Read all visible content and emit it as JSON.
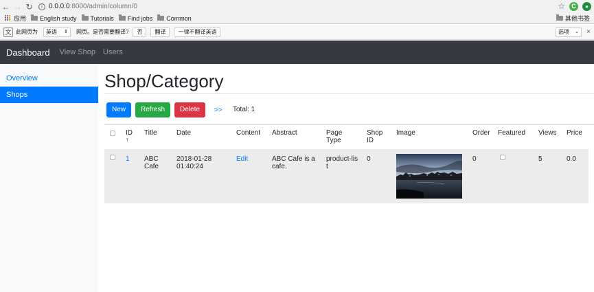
{
  "browser": {
    "url_host": "0.0.0.0",
    "url_path": ":8000/admin/column/0",
    "bookmarks": [
      "应用",
      "English study",
      "Tutorials",
      "Find jobs",
      "Common"
    ],
    "other_bookmarks": "其他书签",
    "ext1": "C",
    "ext2": "●"
  },
  "translate_bar": {
    "prefix": "此网页为",
    "language": "英语",
    "question": "网页。是否需要翻译?",
    "no_btn": "否",
    "translate_btn": "翻译",
    "never_btn": "一律不翻译英语",
    "options": "选项",
    "close": "×"
  },
  "navbar": {
    "brand": "Dashboard",
    "links": [
      "View Shop",
      "Users"
    ]
  },
  "sidebar": {
    "items": [
      {
        "label": "Overview",
        "active": false
      },
      {
        "label": "Shops",
        "active": true
      }
    ]
  },
  "page": {
    "title": "Shop/Category",
    "buttons": {
      "new": "New",
      "refresh": "Refresh",
      "delete": "Delete"
    },
    "next_link": ">>",
    "total": "Total: 1"
  },
  "table": {
    "headers": {
      "id": "ID",
      "sort_indicator": "↑",
      "title": "Title",
      "date": "Date",
      "content": "Content",
      "abstract": "Abstract",
      "page_type": "Page Type",
      "shop_id": "Shop ID",
      "image": "Image",
      "order": "Order",
      "featured": "Featured",
      "views": "Views",
      "price": "Price"
    },
    "rows": [
      {
        "id": "1",
        "title": "ABC Cafe",
        "date": "2018-01-28 01:40:24",
        "content": "Edit",
        "abstract": "ABC Cafe is a cafe.",
        "page_type": "product-list",
        "shop_id": "0",
        "image": "city-river-dusk-photo",
        "order": "0",
        "featured": false,
        "views": "5",
        "price": "0.0"
      }
    ]
  }
}
